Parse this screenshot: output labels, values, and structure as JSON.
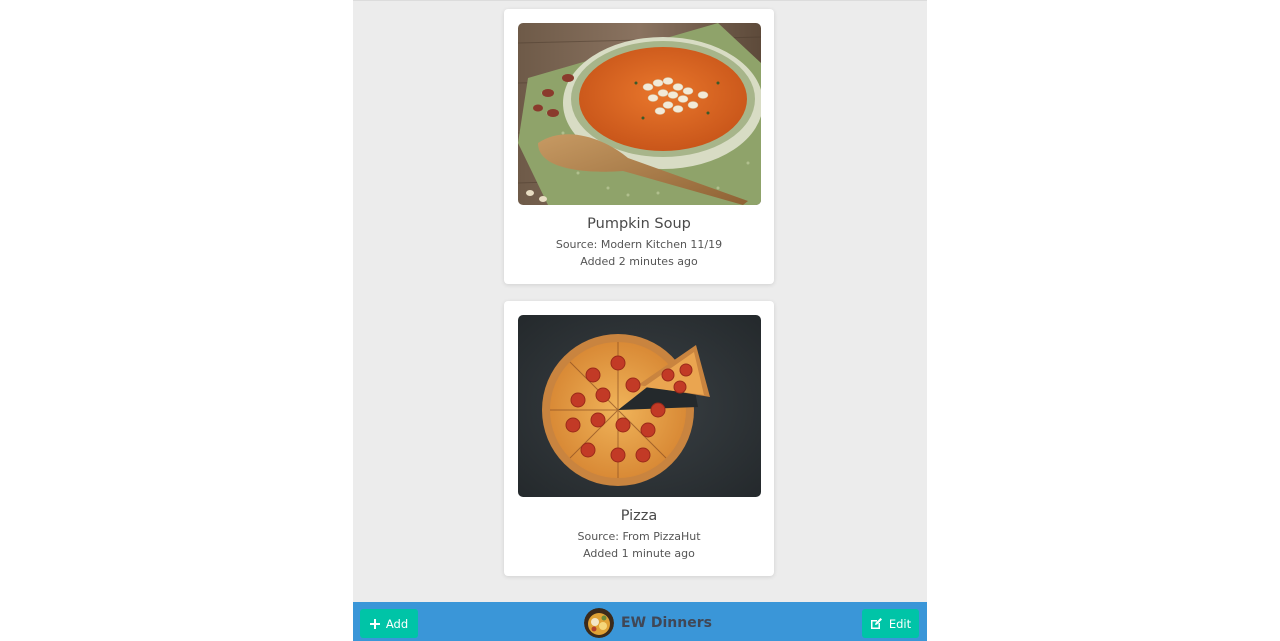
{
  "recipes": [
    {
      "title": "Pumpkin Soup",
      "source": "Source: Modern Kitchen 11/19",
      "added": "Added 2 minutes ago",
      "image": "pumpkin-soup-photo"
    },
    {
      "title": "Pizza",
      "source": "Source: From PizzaHut",
      "added": "Added 1 minute ago",
      "image": "pizza-photo"
    }
  ],
  "footer": {
    "add_label": "Add",
    "add_icon": "plus-icon",
    "edit_label": "Edit",
    "edit_icon": "edit-icon",
    "brand_name": "EW Dinners",
    "brand_logo": "dinner-logo"
  },
  "colors": {
    "footer_bg": "#3a96d8",
    "button_bg": "#00c4a7",
    "page_bg": "#ececec"
  }
}
